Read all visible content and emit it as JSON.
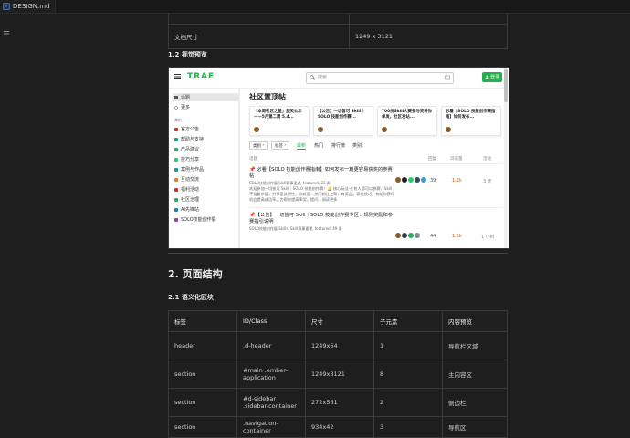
{
  "tab": {
    "title": "DESIGN.md"
  },
  "table1": {
    "rows": [
      [
        "",
        ""
      ],
      [
        "文档尺寸",
        "1249 x 3121"
      ]
    ]
  },
  "section_visual": {
    "title": "1.2 视觉预览"
  },
  "preview": {
    "logo": "TRAE",
    "search_placeholder": "搜索",
    "login_label": "登录",
    "sidebar": {
      "items_top": [
        "话题",
        "更多"
      ],
      "header": "类别",
      "categories": [
        {
          "label": "官方公告",
          "color": "#c0392b"
        },
        {
          "label": "帮助与支持",
          "color": "#16a085"
        },
        {
          "label": "产品建议",
          "color": "#27ae60"
        },
        {
          "label": "技巧分享",
          "color": "#2ecc71"
        },
        {
          "label": "案例与作品",
          "color": "#16a085"
        },
        {
          "label": "互动交流",
          "color": "#e67e22"
        },
        {
          "label": "福利活动",
          "color": "#c0392b"
        },
        {
          "label": "社区治理",
          "color": "#27ae60"
        },
        {
          "label": "AI先锋站",
          "color": "#2980b9"
        },
        {
          "label": "SOLO技能创作展",
          "color": "#8e44ad"
        }
      ]
    },
    "title": "社区置顶帖",
    "cards": [
      "「本周社区之星」颁奖公示——5月第二周 5.4...",
      "【公告】一切皆可 Skill｜SOLO 技能创作赛...",
      "700份Skill大赛参与奖将你单发，社区发站...",
      "必看【SOLO 技能创作赛指南】如何发布..."
    ],
    "nav": {
      "cat_btn": "类别",
      "tag_btn": "标签",
      "tabs": [
        "最新",
        "热门",
        "排行榜",
        "类别"
      ]
    },
    "thead": {
      "topic": "话题",
      "replies": "回复",
      "views": "浏览量",
      "activity": "活动"
    },
    "topics": [
      {
        "title": "📌 必看【SOLO 技能创作赛指南】如何发布一篇更容易获奖的参赛帖",
        "meta": "SOLO技能创作展  Skill赛事速递, featured, 23 条",
        "excerpt": "欢迎参加一切皆可 Skill｜SOLO 技能创作赛！🔔 核心玩法 任何人都可以参赛，Skill不设复杂度，分享是其所性，你就是…关门前注上帮，有奖品。奇迹技巧，有助你获得机会提高成功率。为帮你提高率奖，提问…阅读更多",
        "replies": "39",
        "views": "1.2k",
        "activity": "3 天"
      },
      {
        "title": "📌【公告】一切皆可 Skill｜SOLO 技能创作赛专区：规则奖励和参赛指引说明",
        "meta": "SOLO技能创作展  Skills, Skill赛事速递, featured, 49 条",
        "excerpt": "",
        "replies": "44",
        "views": "1.5k",
        "activity": "1 小时"
      }
    ]
  },
  "section_structure": {
    "title": "2. 页面结构"
  },
  "section_semantic": {
    "title": "2.1 语义化区块"
  },
  "table2": {
    "headers": [
      "标签",
      "ID/Class",
      "尺寸",
      "子元素",
      "内容预览"
    ],
    "rows": [
      [
        "header",
        ".d-header",
        "1249x64",
        "1",
        "导航栏区域"
      ],
      [
        "section",
        "#main .ember-application",
        "1249x3121",
        "8",
        "主内容区"
      ],
      [
        "section",
        "#d-sidebar .sidebar-container",
        "272x561",
        "2",
        "侧边栏"
      ],
      [
        "section",
        ".navigation-container",
        "934x42",
        "3",
        "导航区"
      ]
    ]
  },
  "colors": {
    "accent": "#22b14c",
    "bg": "#1e1e1e",
    "border": "#3a3a3a"
  }
}
